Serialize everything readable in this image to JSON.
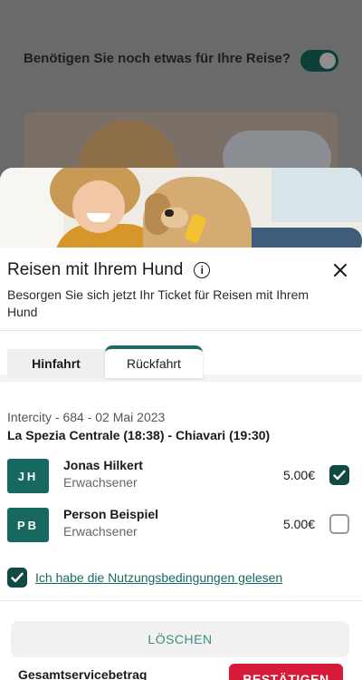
{
  "background": {
    "question": "Benötigen Sie noch etwas für Ihre Reise?"
  },
  "sheet": {
    "title": "Reisen mit Ihrem Hund",
    "info_glyph": "i",
    "close_glyph": "×",
    "subtitle": "Besorgen Sie sich jetzt Ihr Ticket für Reisen mit Ihrem Hund"
  },
  "tabs": [
    {
      "label": "Hinfahrt",
      "active": false
    },
    {
      "label": "Rückfahrt",
      "active": true
    }
  ],
  "trip": {
    "train": "Intercity - 684 - 02 Mai 2023",
    "route": "La Spezia Centrale (18:38) - Chiavari (19:30)"
  },
  "passengers": [
    {
      "initials": "JH",
      "name": "Jonas Hilkert",
      "type": "Erwachsener",
      "price": "5.00€",
      "selected": true
    },
    {
      "initials": "PB",
      "name": "Person Beispiel",
      "type": "Erwachsener",
      "price": "5.00€",
      "selected": false
    }
  ],
  "terms": {
    "label": "Ich habe die Nutzungsbedingungen gelesen",
    "checked": true
  },
  "footer": {
    "clear_label": "LÖSCHEN",
    "total_label": "Gesamtservicebetrag",
    "confirm_label": "BESTÄTIGEN"
  },
  "colors": {
    "primary_teal": "#17695f",
    "dark_teal": "#0f4a44",
    "confirm_red": "#d7193a"
  },
  "icons": [
    "info-icon",
    "close-icon",
    "checkmark-icon"
  ]
}
